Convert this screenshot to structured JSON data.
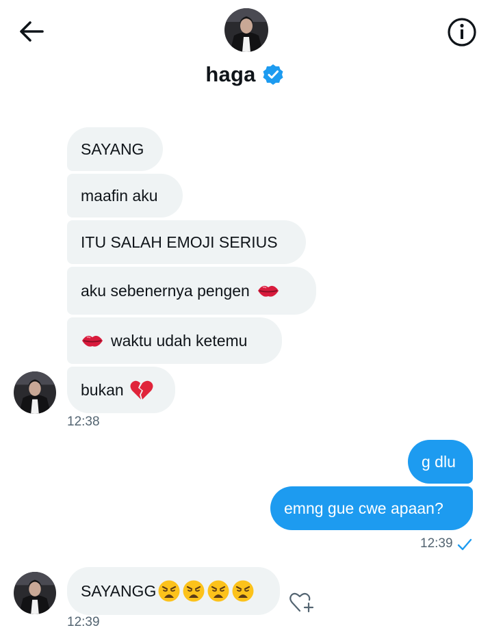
{
  "header": {
    "back_icon": "arrow-left-icon",
    "name": "haga",
    "verified_icon": "verified-badge-icon",
    "info_icon": "info-circle-icon"
  },
  "colors": {
    "sent_bubble": "#1d9bf0",
    "received_bubble": "#eff3f4",
    "verified": "#1d9bf0",
    "timestamp": "#536471"
  },
  "messages": {
    "m1": "SAYANG",
    "m2": "maafin aku",
    "m3": "ITU SALAH EMOJI SERIUS",
    "m4": "aku sebenernya pengen",
    "m5": "waktu udah ketemu",
    "m6": "bukan",
    "time1": "12:38",
    "s1": "g dlu",
    "s2": "emng gue cwe apaan?",
    "time2": "12:39",
    "m7": "SAYANGG",
    "time3": "12:39"
  },
  "icons": {
    "kiss": "kiss-mark-emoji",
    "broken_heart": "broken-heart-emoji",
    "weary": "weary-face-emoji",
    "read_check": "check-icon",
    "react": "heart-plus-icon"
  }
}
